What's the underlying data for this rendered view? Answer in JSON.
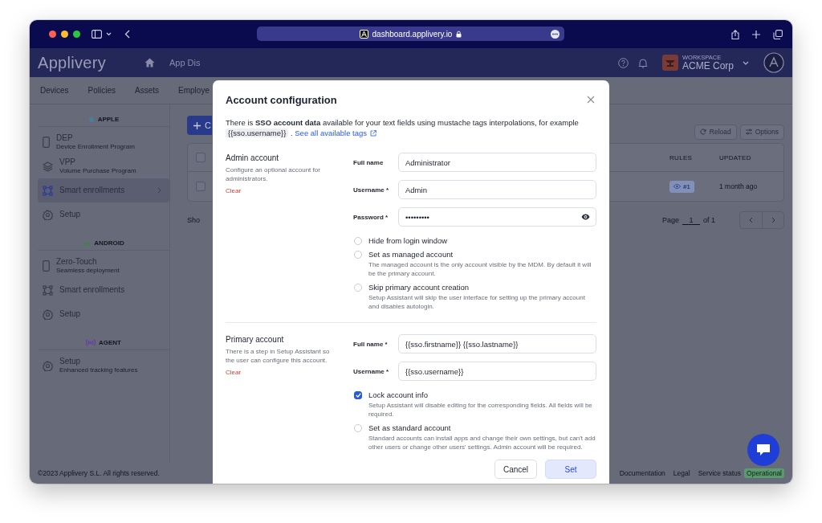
{
  "browser": {
    "url": "dashboard.applivery.io"
  },
  "app": {
    "logo": "Applivery",
    "nav_cut": "App Dis",
    "workspace": {
      "label": "WORKSPACE",
      "name": "ACME Corp"
    },
    "tabs": [
      "Devices",
      "Policies",
      "Assets",
      "Employe"
    ],
    "sidebar": [
      {
        "kind": "apple",
        "title": "APPLE",
        "items": [
          {
            "kind": "phone",
            "label": "DEP",
            "sublabel": "Device Enrollment Program",
            "selected": false
          },
          {
            "kind": "layers",
            "label": "VPP",
            "sublabel": "Volume Purchase Program",
            "selected": false
          },
          {
            "kind": "nodes",
            "label": "Smart enrollments",
            "selected": true
          },
          {
            "kind": "gear",
            "label": "Setup",
            "selected": false
          }
        ]
      },
      {
        "kind": "android",
        "title": "ANDROID",
        "items": [
          {
            "kind": "phone",
            "label": "Zero-Touch",
            "sublabel": "Seamless deployment",
            "selected": false
          },
          {
            "kind": "nodes",
            "label": "Smart enrollments",
            "selected": false
          },
          {
            "kind": "gear",
            "label": "Setup",
            "selected": false
          }
        ]
      },
      {
        "kind": "agent",
        "title": "AGENT",
        "items": [
          {
            "kind": "gear",
            "label": "Setup",
            "sublabel": "Enhanced tracking features",
            "selected": false
          }
        ]
      }
    ],
    "main": {
      "create_button": "C",
      "all_selected": false,
      "actions": [
        {
          "kind": "reload",
          "label": "Reload"
        },
        {
          "kind": "options",
          "label": "Options"
        }
      ],
      "columns": [
        "RULES",
        "UPDATED"
      ],
      "rows": [
        {
          "checked": false,
          "rules": "#1",
          "updated": "1 month ago"
        }
      ],
      "showing": "Sho",
      "pagination": {
        "label": "Page",
        "page": "1",
        "total": "of 1"
      }
    },
    "footer": {
      "copyright": "©2023 Applivery S.L. All rights reserved.",
      "links": [
        "Documentation",
        "Legal",
        "Service status"
      ],
      "status": "Operational"
    }
  },
  "modal": {
    "title": "Account configuration",
    "intro": "There is **SSO account data** available for your text fields using mustache tags interpolations, for example",
    "intro_code": "{{sso.username}}",
    "intro_sep": ".",
    "intro_link": "See all available tags",
    "sections": [
      {
        "title": "Admin account",
        "description": "Configure an optional account for administrators.",
        "clear": "Clear",
        "fields": [
          {
            "label": "Full name",
            "value": "Administrator",
            "kind": "text"
          },
          {
            "label": "Username *",
            "value": "Admin",
            "kind": "text"
          },
          {
            "label": "Password *",
            "value": "•••••••••",
            "kind": "password"
          }
        ],
        "options": [
          {
            "label": "Hide from login window",
            "checked": false
          },
          {
            "label": "Set as managed account",
            "description": "The managed account is the only account visible by the MDM. By default it will be the primary account.",
            "checked": false
          },
          {
            "label": "Skip primary account creation",
            "description": "Setup Assistant will skip the user interface for setting up the primary account and disables autologin.",
            "checked": false
          }
        ]
      },
      {
        "title": "Primary account",
        "description": "There is a step in Setup Assistant so the user can configure this account.",
        "clear": "Clear",
        "fields": [
          {
            "label": "Full name *",
            "value": "{{sso.firstname}} {{sso.lastname}}",
            "kind": "text"
          },
          {
            "label": "Username *",
            "value": "{{sso.username}}",
            "kind": "text"
          }
        ],
        "options": [
          {
            "label": "Lock account info",
            "description": "Setup Assistant will disable editing for the corresponding fields. All fields will be required.",
            "checked": true
          },
          {
            "label": "Set as standard account",
            "description": "Standard accounts can install apps and change their own settings, but can't add other users or change other users' settings. Admin account will be required.",
            "checked": false
          }
        ]
      }
    ],
    "buttons": [
      {
        "kind": "secondary",
        "label": "Cancel"
      },
      {
        "kind": "primary",
        "label": "Set"
      }
    ]
  }
}
